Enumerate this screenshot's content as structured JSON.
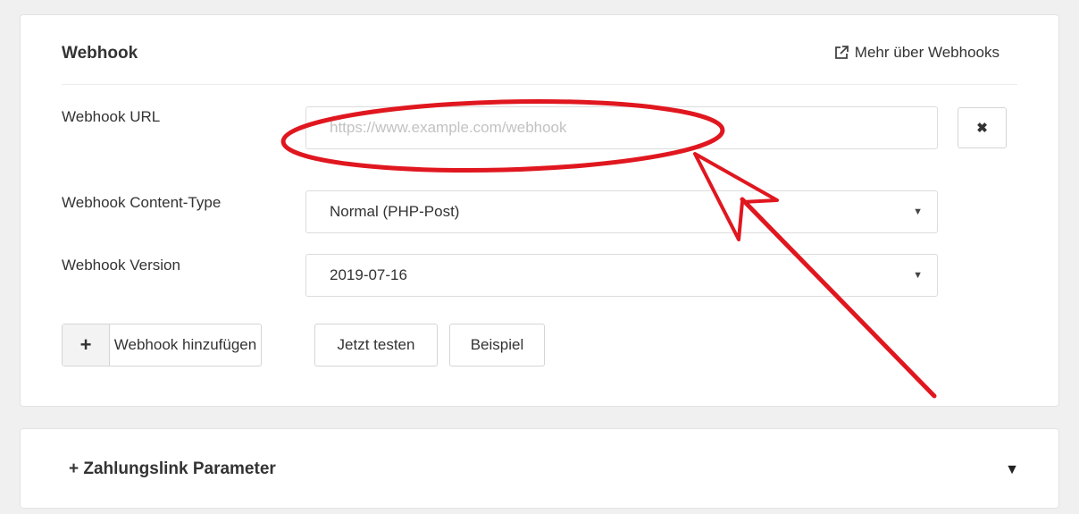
{
  "webhook": {
    "title": "Webhook",
    "more_link": "Mehr über Webhooks",
    "url_label": "Webhook URL",
    "url_placeholder": "https://www.example.com/webhook",
    "url_value": "",
    "clear_symbol": "✖",
    "content_type_label": "Webhook Content-Type",
    "content_type_value": "Normal (PHP-Post)",
    "version_label": "Webhook Version",
    "version_value": "2019-07-16",
    "add_symbol": "+",
    "add_label": "Webhook hinzufügen",
    "test_label": "Jetzt testen",
    "example_label": "Beispiel"
  },
  "param_panel": {
    "title": "+  Zahlungslink Parameter"
  },
  "colors": {
    "annotation": "#e0171f"
  },
  "icons": {
    "external_link": "external-link-icon",
    "clear": "close-icon",
    "select_caret": "caret-down-icon",
    "panel_toggle": "caret-down-icon"
  }
}
